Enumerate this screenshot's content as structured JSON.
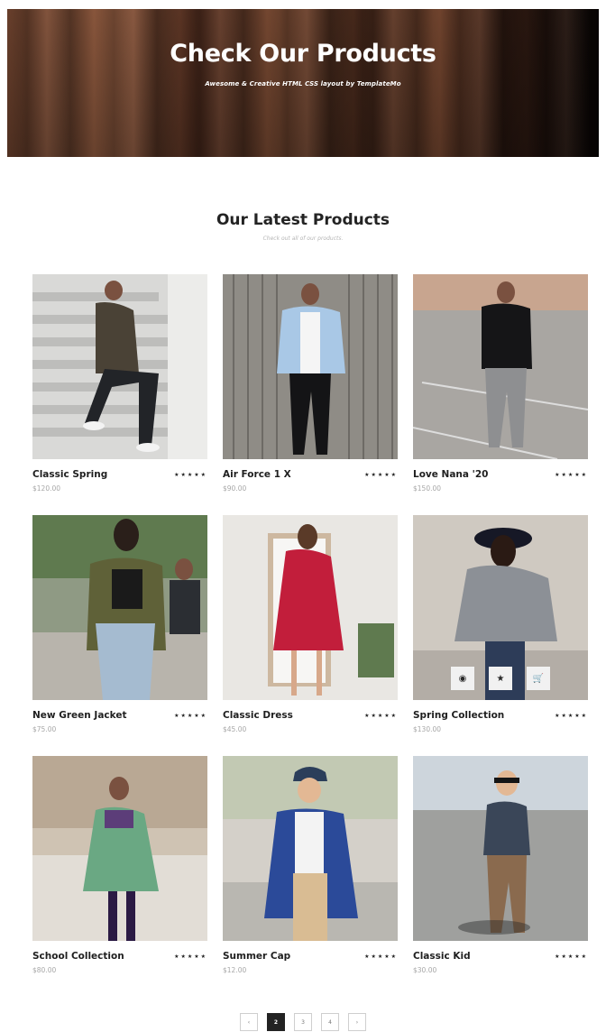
{
  "hero": {
    "title": "Check Our Products",
    "subtitle": "Awesome & Creative HTML CSS layout by TemplateMo"
  },
  "section": {
    "title": "Our Latest Products",
    "subtitle": "Check out all of our products."
  },
  "products": [
    {
      "name": "Classic Spring",
      "price": "$120.00",
      "rating": "★★★★★"
    },
    {
      "name": "Air Force 1 X",
      "price": "$90.00",
      "rating": "★★★★★"
    },
    {
      "name": "Love Nana '20",
      "price": "$150.00",
      "rating": "★★★★★"
    },
    {
      "name": "New Green Jacket",
      "price": "$75.00",
      "rating": "★★★★★"
    },
    {
      "name": "Classic Dress",
      "price": "$45.00",
      "rating": "★★★★★"
    },
    {
      "name": "Spring Collection",
      "price": "$130.00",
      "rating": "★★★★★"
    },
    {
      "name": "School Collection",
      "price": "$80.00",
      "rating": "★★★★★"
    },
    {
      "name": "Summer Cap",
      "price": "$12.00",
      "rating": "★★★★★"
    },
    {
      "name": "Classic Kid",
      "price": "$30.00",
      "rating": "★★★★★"
    }
  ],
  "hover_actions": {
    "view_icon": "eye-icon",
    "star_icon": "star-icon",
    "cart_icon": "cart-icon",
    "view": "◉",
    "star": "★",
    "cart": "🛒"
  },
  "pagination": {
    "first": "‹",
    "pages": [
      "2",
      "3",
      "4"
    ],
    "last": "›",
    "active": "2"
  }
}
